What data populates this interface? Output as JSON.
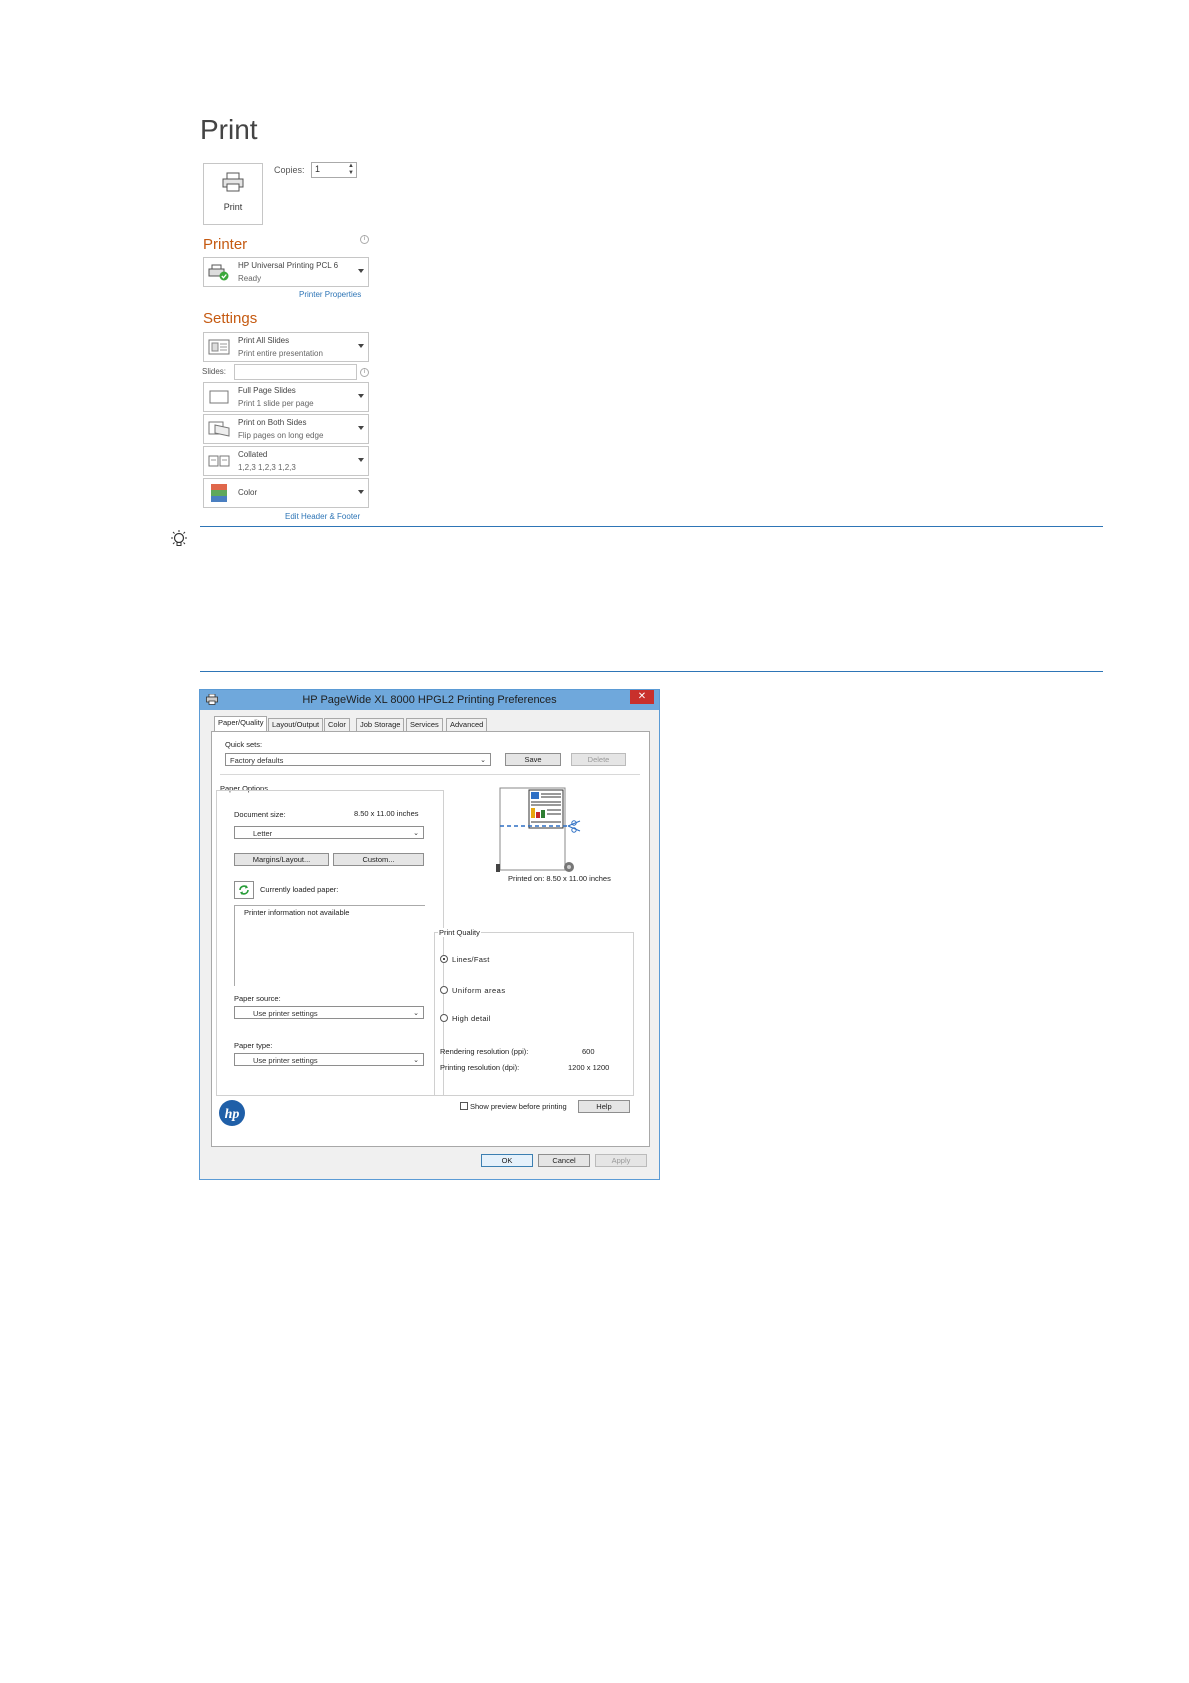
{
  "backstage": {
    "title": "Print",
    "print_button_label": "Print",
    "copies_label": "Copies:",
    "copies_value": "1",
    "printer_heading": "Printer",
    "printer_name": "HP Universal Printing PCL 6",
    "printer_status": "Ready",
    "printer_properties_link": "Printer Properties",
    "settings_heading": "Settings",
    "settings": [
      {
        "title": "Print All Slides",
        "subtitle": "Print entire presentation"
      },
      {
        "title": "Full Page Slides",
        "subtitle": "Print 1 slide per page"
      },
      {
        "title": "Print on Both Sides",
        "subtitle": "Flip pages on long edge"
      },
      {
        "title": "Collated",
        "subtitle": "1,2,3    1,2,3    1,2,3"
      },
      {
        "title": "Color",
        "subtitle": ""
      }
    ],
    "slides_label": "Slides:",
    "edit_header_footer_link": "Edit Header & Footer"
  },
  "dialog": {
    "title": "HP PageWide XL 8000 HPGL2 Printing Preferences",
    "tabs": [
      "Paper/Quality",
      "Layout/Output",
      "Color",
      "Job Storage",
      "Services",
      "Advanced"
    ],
    "quick_sets_label": "Quick sets:",
    "quick_sets_value": "Factory defaults",
    "save_label": "Save",
    "delete_label": "Delete",
    "paper_options_label": "Paper Options",
    "document_size_label": "Document size:",
    "document_size_value": "8.50 x 11.00 inches",
    "paper_size_value": "Letter",
    "margins_button": "Margins/Layout...",
    "custom_button": "Custom...",
    "currently_loaded_label": "Currently loaded paper:",
    "printer_info_text": "Printer information not available",
    "paper_source_label": "Paper source:",
    "paper_source_value": "Use printer settings",
    "paper_type_label": "Paper type:",
    "paper_type_value": "Use printer settings",
    "printed_on": "Printed on: 8.50 x 11.00 inches",
    "print_quality_label": "Print Quality",
    "quality_options": [
      "Lines/Fast",
      "Uniform  areas",
      "High detail"
    ],
    "quality_selected": "Lines/Fast",
    "rendering_res_label": "Rendering resolution (ppi):",
    "rendering_res_value": "600",
    "printing_res_label": "Printing resolution (dpi):",
    "printing_res_value": "1200 x 1200",
    "show_preview_label": "Show preview before printing",
    "help_label": "Help",
    "ok_label": "OK",
    "cancel_label": "Cancel",
    "apply_label": "Apply",
    "brand_color": "#1f5fa8"
  }
}
